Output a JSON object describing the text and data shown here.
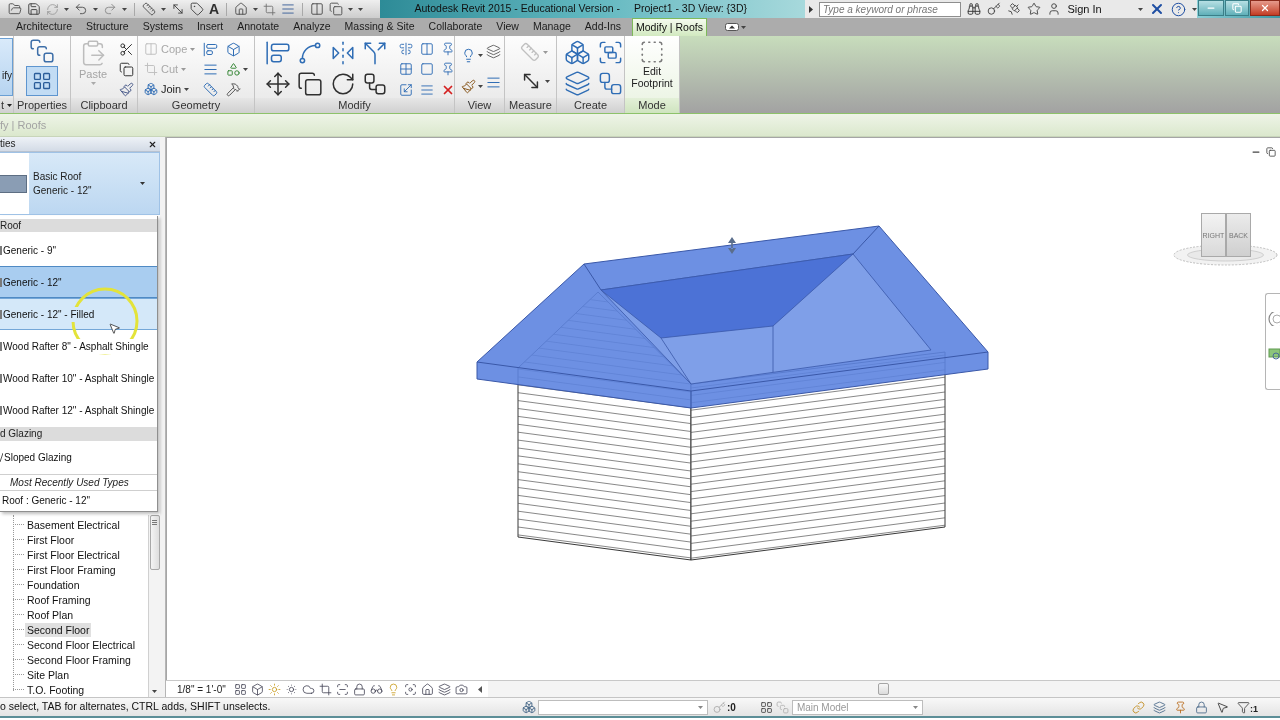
{
  "title_bar": {
    "quick_access_text_button": "A",
    "app_title": "Autodesk Revit 2015 - Educational Version -",
    "view_title": "Project1 - 3D View: {3D}",
    "search": {
      "placeholder": "Type a keyword or phrase"
    },
    "sign_in": "Sign In"
  },
  "ribbon": {
    "tabs": [
      {
        "label": "Architecture",
        "selected": false
      },
      {
        "label": "Structure",
        "selected": false
      },
      {
        "label": "Systems",
        "selected": false
      },
      {
        "label": "Insert",
        "selected": false
      },
      {
        "label": "Annotate",
        "selected": false
      },
      {
        "label": "Analyze",
        "selected": false
      },
      {
        "label": "Massing & Site",
        "selected": false
      },
      {
        "label": "Collaborate",
        "selected": false
      },
      {
        "label": "View",
        "selected": false
      },
      {
        "label": "Manage",
        "selected": false
      },
      {
        "label": "Add-Ins",
        "selected": false
      },
      {
        "label": "Modify | Roofs",
        "selected": true
      }
    ],
    "panels": [
      {
        "kind": "select",
        "label": "t",
        "button": {
          "label": "ify",
          "on": true
        }
      },
      {
        "kind": "properties",
        "label": "Properties",
        "palette_on": true
      },
      {
        "kind": "clipboard",
        "label": "Clipboard",
        "paste": {
          "label": "Paste",
          "disabled": true
        }
      },
      {
        "kind": "geometry",
        "label": "Geometry",
        "tools": [
          {
            "label": "Cope",
            "disabled": true
          },
          {
            "label": "Cut",
            "disabled": true
          },
          {
            "label": "Join",
            "disabled": false
          }
        ]
      },
      {
        "kind": "modify",
        "label": "Modify"
      },
      {
        "kind": "view",
        "label": "View"
      },
      {
        "kind": "measure",
        "label": "Measure"
      },
      {
        "kind": "create",
        "label": "Create"
      },
      {
        "kind": "mode",
        "label": "Mode",
        "button": "Edit Footprint"
      }
    ]
  },
  "options_bar": {
    "context": "fy | Roofs"
  },
  "properties": {
    "title": "ties",
    "type_selector": {
      "family": "Basic Roof",
      "type": "Generic - 12\""
    }
  },
  "type_dropdown": {
    "groups": [
      {
        "name": "Roof",
        "types": [
          {
            "name": "Generic - 9\"",
            "selected": false,
            "hovered": false
          },
          {
            "name": "Generic - 12\"",
            "selected": true,
            "hovered": false
          },
          {
            "name": "Generic - 12\" - Filled",
            "selected": false,
            "hovered": true
          },
          {
            "name": "Wood Rafter 8\" - Asphalt Shingle",
            "selected": false,
            "hovered": false
          },
          {
            "name": "Wood Rafter 10\" - Asphalt Shingle",
            "selected": false,
            "hovered": false
          },
          {
            "name": "Wood Rafter 12\" - Asphalt Shingle",
            "selected": false,
            "hovered": false
          }
        ]
      },
      {
        "name": "d Glazing",
        "types": [
          {
            "name": "Sloped Glazing",
            "selected": false,
            "hovered": false
          }
        ]
      }
    ],
    "recent": {
      "title": "Most Recently Used Types",
      "items": [
        "Roof : Generic - 12\""
      ]
    }
  },
  "project_browser": {
    "items": [
      {
        "name": "Basement Electrical",
        "selected": false
      },
      {
        "name": "First Floor",
        "selected": false
      },
      {
        "name": "First Floor Electrical",
        "selected": false
      },
      {
        "name": "First Floor Framing",
        "selected": false
      },
      {
        "name": "Foundation",
        "selected": false
      },
      {
        "name": "Roof Framing",
        "selected": false
      },
      {
        "name": "Roof Plan",
        "selected": false
      },
      {
        "name": "Second Floor",
        "selected": true
      },
      {
        "name": "Second Floor Electrical",
        "selected": false
      },
      {
        "name": "Second Floor Framing",
        "selected": false
      },
      {
        "name": "Site Plan",
        "selected": false
      },
      {
        "name": "T.O. Footing",
        "selected": false
      }
    ]
  },
  "view": {
    "view_cube": {
      "faces": [
        "RIGHT",
        "BACK"
      ]
    },
    "scale": "1/8\" = 1'-0\""
  },
  "status_bar": {
    "hint": "o select, TAB for alternates, CTRL adds, SHIFT unselects.",
    "counter": ":0",
    "design_option": "Main Model",
    "filter_count": ":1"
  }
}
